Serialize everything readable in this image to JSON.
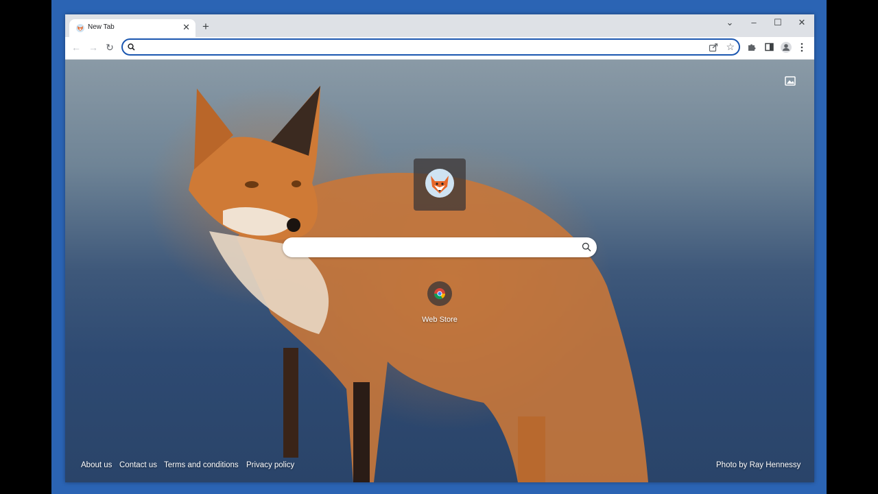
{
  "browser": {
    "tab": {
      "title": "New Tab"
    },
    "omnibox": {
      "value": "",
      "placeholder": ""
    }
  },
  "new_tab_page": {
    "search": {
      "value": "",
      "placeholder": ""
    },
    "shortcuts": [
      {
        "label": "Web Store",
        "icon": "chrome-icon"
      }
    ],
    "footer_links": [
      "About us",
      "Contact us",
      "Terms and conditions",
      "Privacy policy"
    ],
    "photo_credit": "Photo by Ray Hennessy"
  },
  "colors": {
    "accent": "#1a56b0",
    "frame": "#2b64b4",
    "tab_strip": "#dee1e6"
  }
}
